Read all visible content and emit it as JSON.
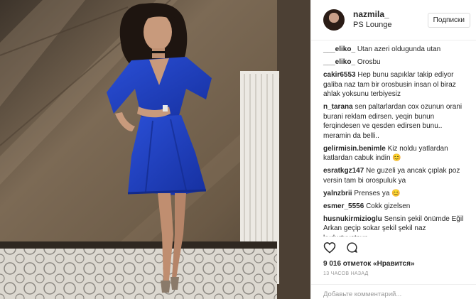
{
  "header": {
    "username": "nazmila_",
    "location": "PS Lounge",
    "follow_label": "Подписки"
  },
  "comments": [
    {
      "user": "___eliko_",
      "text": "Utan azeri oldugunda utan"
    },
    {
      "user": "___eliko_",
      "text": "Orosbu"
    },
    {
      "user": "cakir6553",
      "text": "Hep bunu sapıklar takip ediyor galiba naz tam bir orosbusin insan ol biraz ahlak yoksunu terbiyesiz"
    },
    {
      "user": "n_tarana",
      "text": "sen paltarlardan cox ozunun orani burani reklam edirsen. yeqin bunun ferqindesen ve qesden edirsen bunu.. meramin da belli.."
    },
    {
      "user": "gelirmisin.benimle",
      "text": "Kiz noldu yatlardan katlardan cabuk indin 😊"
    },
    {
      "user": "esratkgz147",
      "text": "Ne guzeli ya ancak çıplak poz versin tam bi orospuluk ya"
    },
    {
      "user": "yalnzbrii",
      "text": "Prenses ya 😊"
    },
    {
      "user": "esmer_5556",
      "text": "Cokk gizelsen"
    },
    {
      "user": "husnukirmizioglu",
      "text": "Sensin şekil önümde Eğil Arkan geçip sokar şekil şekil naz kudurtuyotsun"
    }
  ],
  "actions": {
    "like_icon": "heart-icon",
    "comment_icon": "comment-icon"
  },
  "likes": "9 016 отметок «Нравится»",
  "timestamp": "13 ЧАСОВ НАЗАД",
  "add_comment": {
    "placeholder": "Добавьте комментарий..."
  },
  "colors": {
    "dress": "#1f3fc0",
    "wall": "#6b5a45",
    "floor": "#d8d4cc"
  }
}
